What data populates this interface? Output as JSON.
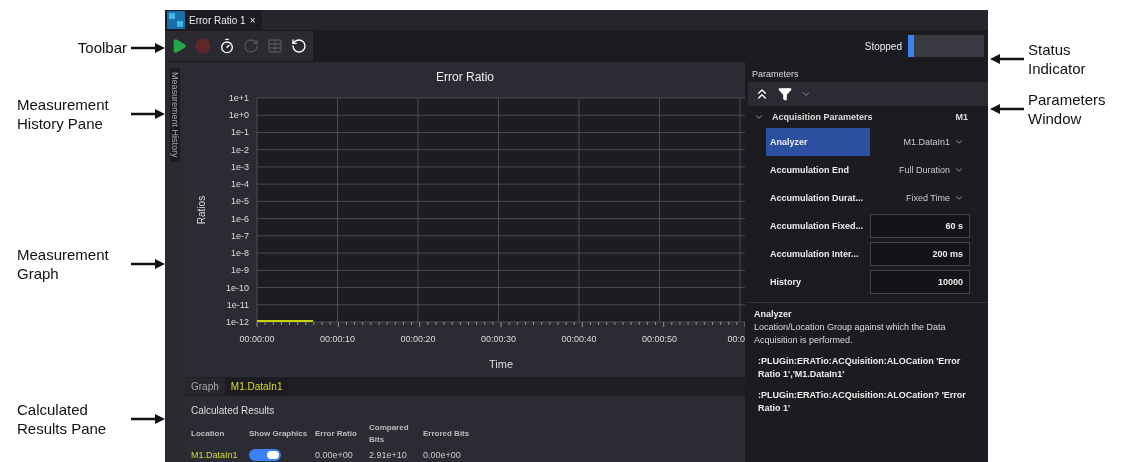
{
  "callouts": {
    "left": [
      {
        "text": "Toolbar"
      },
      {
        "text": "Measurement History Pane"
      },
      {
        "text": "Measurement Graph"
      },
      {
        "text": "Calculated Results Pane"
      }
    ],
    "right": [
      {
        "text": "Status Indicator"
      },
      {
        "text": "Parameters Window"
      }
    ]
  },
  "tab": {
    "title": "Error Ratio 1",
    "close": "×"
  },
  "toolbar": {
    "buttons": [
      {
        "kind": "run",
        "disabled": false
      },
      {
        "kind": "stop",
        "disabled": true
      },
      {
        "kind": "timer",
        "disabled": false
      },
      {
        "kind": "single",
        "disabled": true
      },
      {
        "kind": "table",
        "disabled": true
      },
      {
        "kind": "reset",
        "disabled": false
      }
    ]
  },
  "status": {
    "text": "Stopped"
  },
  "history_pane": {
    "label": "Measurement History"
  },
  "graph": {
    "title": "Error Ratio",
    "x_axis": {
      "title": "Time",
      "labels": [
        "00:00:00",
        "00:00:10",
        "00:00:20",
        "00:00:30",
        "00:00:40",
        "00:00:50",
        "00:0"
      ]
    },
    "y_axis": {
      "title": "Ratios",
      "labels": [
        "1e+1",
        "1e+0",
        "1e-1",
        "1e-2",
        "1e-3",
        "1e-4",
        "1e-5",
        "1e-6",
        "1e-7",
        "1e-8",
        "1e-9",
        "1e-10",
        "1e-11",
        "1e-12"
      ]
    }
  },
  "graph_tabs": [
    {
      "label": "Graph",
      "selected": false
    },
    {
      "label": "M1.DataIn1",
      "selected": true
    }
  ],
  "results": {
    "title": "Calculated Results",
    "columns": [
      "Location",
      "Show Graphics",
      "Error Ratio",
      "Compared Bits",
      "Errored Bits"
    ],
    "rows": [
      {
        "location": "M1.DataIn1",
        "show_graphics": true,
        "error_ratio": "0.00e+00",
        "compared_bits": "2.91e+10",
        "errored_bits": "0.00e+00"
      }
    ]
  },
  "parameters": {
    "title": "Parameters",
    "group": {
      "label": "Acquisition Parameters",
      "badge": "M1",
      "expanded": true
    },
    "rows": [
      {
        "label": "Analyzer",
        "value": "M1.DataIn1",
        "kind": "dropdown",
        "selected": true
      },
      {
        "label": "Accumulation End",
        "value": "Full Duration",
        "kind": "dropdown",
        "selected": false
      },
      {
        "label": "Accumulation Durat...",
        "value": "Fixed Time",
        "kind": "dropdown",
        "selected": false
      },
      {
        "label": "Accumulation Fixed...",
        "value": "60 s",
        "kind": "input",
        "selected": false
      },
      {
        "label": "Accumulation Inter...",
        "value": "200 ms",
        "kind": "input",
        "selected": false
      },
      {
        "label": "History",
        "value": "10000",
        "kind": "input",
        "selected": false
      }
    ],
    "help": {
      "title": "Analyzer",
      "text": "Location/Location Group against which the Data Acquisition is performed.",
      "commands": [
        ":PLUGin:ERATio:ACQuisition:ALOCation 'Error Ratio 1','M1.DataIn1'",
        ":PLUGin:ERATio:ACQuisition:ALOCation? 'Error Ratio 1'"
      ]
    }
  }
}
